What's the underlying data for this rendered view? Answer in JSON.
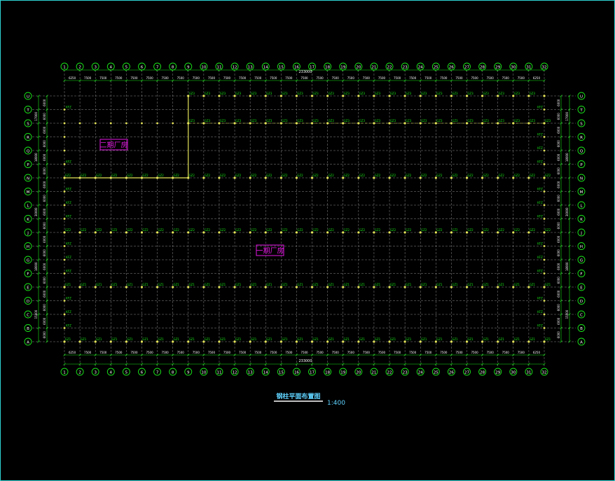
{
  "drawing": {
    "title": "钢柱平面布置图",
    "scale": "1:400",
    "zone_phase2": "二期厂房",
    "zone_phase1": "一期厂房",
    "overall_dim_top": "233000",
    "overall_dim_bottom": "233000",
    "grid_columns": [
      "1",
      "2",
      "3",
      "4",
      "5",
      "6",
      "7",
      "8",
      "9",
      "10",
      "11",
      "12",
      "13",
      "14",
      "15",
      "16",
      "17",
      "18",
      "19",
      "20",
      "21",
      "22",
      "23",
      "24",
      "25",
      "26",
      "27",
      "28",
      "29",
      "30",
      "31",
      "32"
    ],
    "grid_rows_top_to_bottom": [
      "U",
      "T",
      "S",
      "R",
      "Q",
      "P",
      "N",
      "M",
      "L",
      "K",
      "J",
      "H",
      "G",
      "F",
      "E",
      "D",
      "C",
      "B",
      "A"
    ],
    "bay_dims": [
      "6250",
      "7500",
      "7500",
      "7500",
      "7500",
      "7500",
      "7500",
      "7500",
      "7500",
      "7500",
      "7500",
      "7500",
      "7500",
      "7500",
      "7500",
      "7500",
      "7500",
      "7500",
      "7500",
      "7500",
      "7500",
      "7500",
      "7500",
      "7500",
      "7500",
      "7500",
      "7500",
      "7500",
      "7500",
      "7500",
      "6250"
    ],
    "row_dims_left": [
      "6000",
      "6000",
      "6000",
      "6000",
      "6000",
      "6000",
      "6000",
      "6000",
      "6000",
      "6000",
      "6000",
      "6000",
      "6000",
      "6000",
      "6000",
      "6000",
      "6000",
      "6000"
    ],
    "row_dims_right": [
      "6000",
      "6000",
      "6000",
      "6000",
      "6000",
      "6000",
      "6000",
      "6000",
      "6000",
      "6000",
      "6000",
      "6000",
      "6000",
      "6000",
      "6000",
      "6000",
      "6000",
      "6000"
    ],
    "side_totals_left": [
      "17000",
      "18000",
      "30000",
      "18000",
      "15000"
    ],
    "side_totals_right": [
      "17000",
      "18000",
      "30000",
      "18000",
      "15000"
    ],
    "column_tag_gz1": "GZ1",
    "column_tag_gz2": "GZ2",
    "column_tag_gz3": "GZ3",
    "column_tag_kfz": "KFZ",
    "colors": {
      "background": "#000000",
      "frame": "#2fd3d3",
      "axis": "#19e619",
      "grid": "#8a8a8a",
      "column": "#e6e65a",
      "tag": "#19e619",
      "zone": "#e619e6",
      "title": "#5fd3ff",
      "phase2_boundary": "#e6e65a"
    }
  }
}
